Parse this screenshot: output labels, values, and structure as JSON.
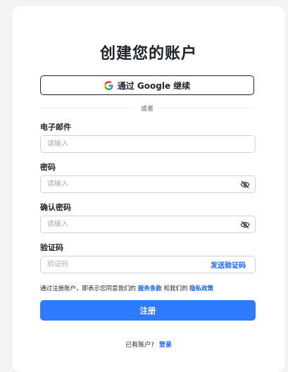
{
  "page": {
    "title": "创建您的账户"
  },
  "google": {
    "label": "通过 Google 继续",
    "icon": "google-icon"
  },
  "divider": {
    "text": "或者"
  },
  "email": {
    "label": "电子邮件",
    "placeholder": "请输入"
  },
  "password": {
    "label": "密码",
    "placeholder": "请输入"
  },
  "confirm": {
    "label": "确认密码",
    "placeholder": "请输入"
  },
  "code": {
    "label": "验证码",
    "placeholder": "验证码",
    "send_label": "发送验证码"
  },
  "agreement": {
    "prefix": "通过注册账户，即表示您同意我们的",
    "terms": "服务条款",
    "middle": "和我们的",
    "privacy": "隐私政策"
  },
  "submit": {
    "label": "注册"
  },
  "footer": {
    "question": "已有账户?",
    "login": "登录"
  },
  "colors": {
    "accent": "#1664ff",
    "button": "#2f7bff"
  }
}
